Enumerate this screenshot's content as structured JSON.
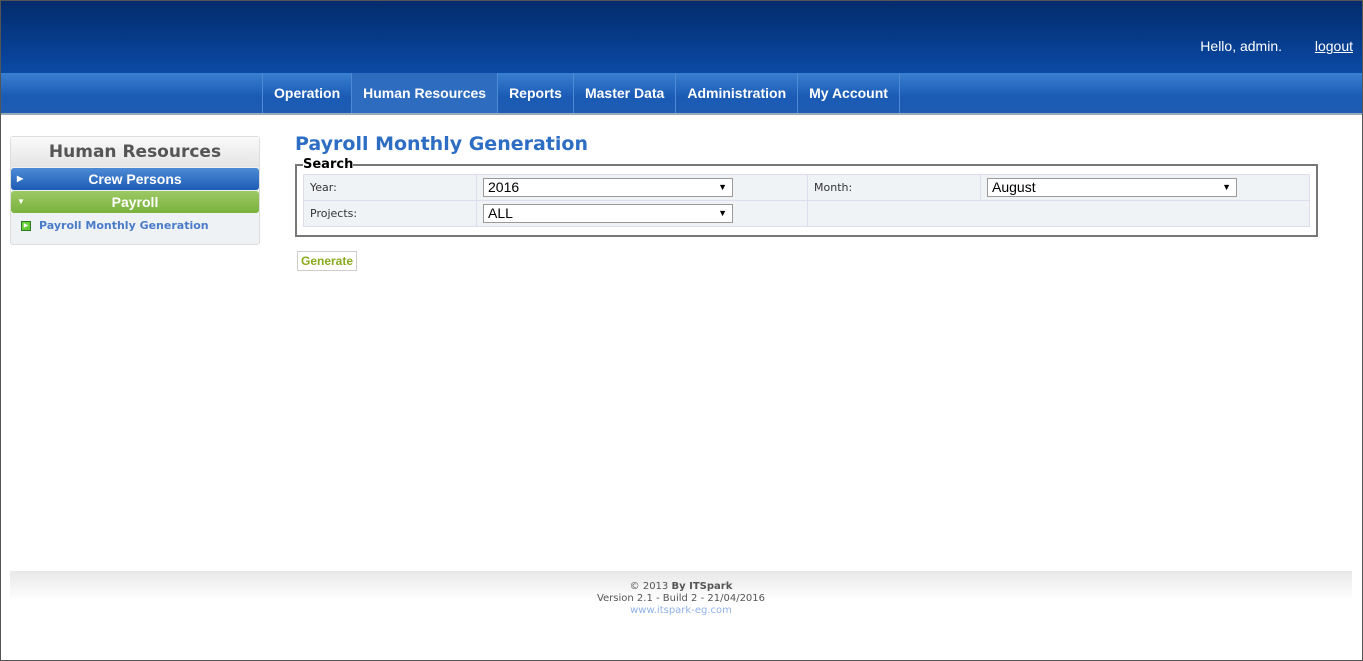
{
  "header": {
    "greeting": "Hello, admin.",
    "logout": "logout"
  },
  "nav": [
    "Operation",
    "Human Resources",
    "Reports",
    "Master Data",
    "Administration",
    "My Account"
  ],
  "sidebar": {
    "title": "Human Resources",
    "groups": [
      {
        "label": "Crew Persons"
      },
      {
        "label": "Payroll"
      }
    ],
    "items": [
      "Payroll Monthly Generation"
    ]
  },
  "page": {
    "title": "Payroll Monthly Generation",
    "legend": "Search",
    "year_label": "Year:",
    "year": "2016",
    "month_label": "Month:",
    "month": "August",
    "projects_label": "Projects:",
    "projects": "ALL",
    "generate": "Generate"
  },
  "footer": {
    "copyright": "© 2013",
    "by": "By ITSpark",
    "version": "Version 2.1 - Build 2 - 21/04/2016",
    "site": "www.itspark-eg.com"
  }
}
